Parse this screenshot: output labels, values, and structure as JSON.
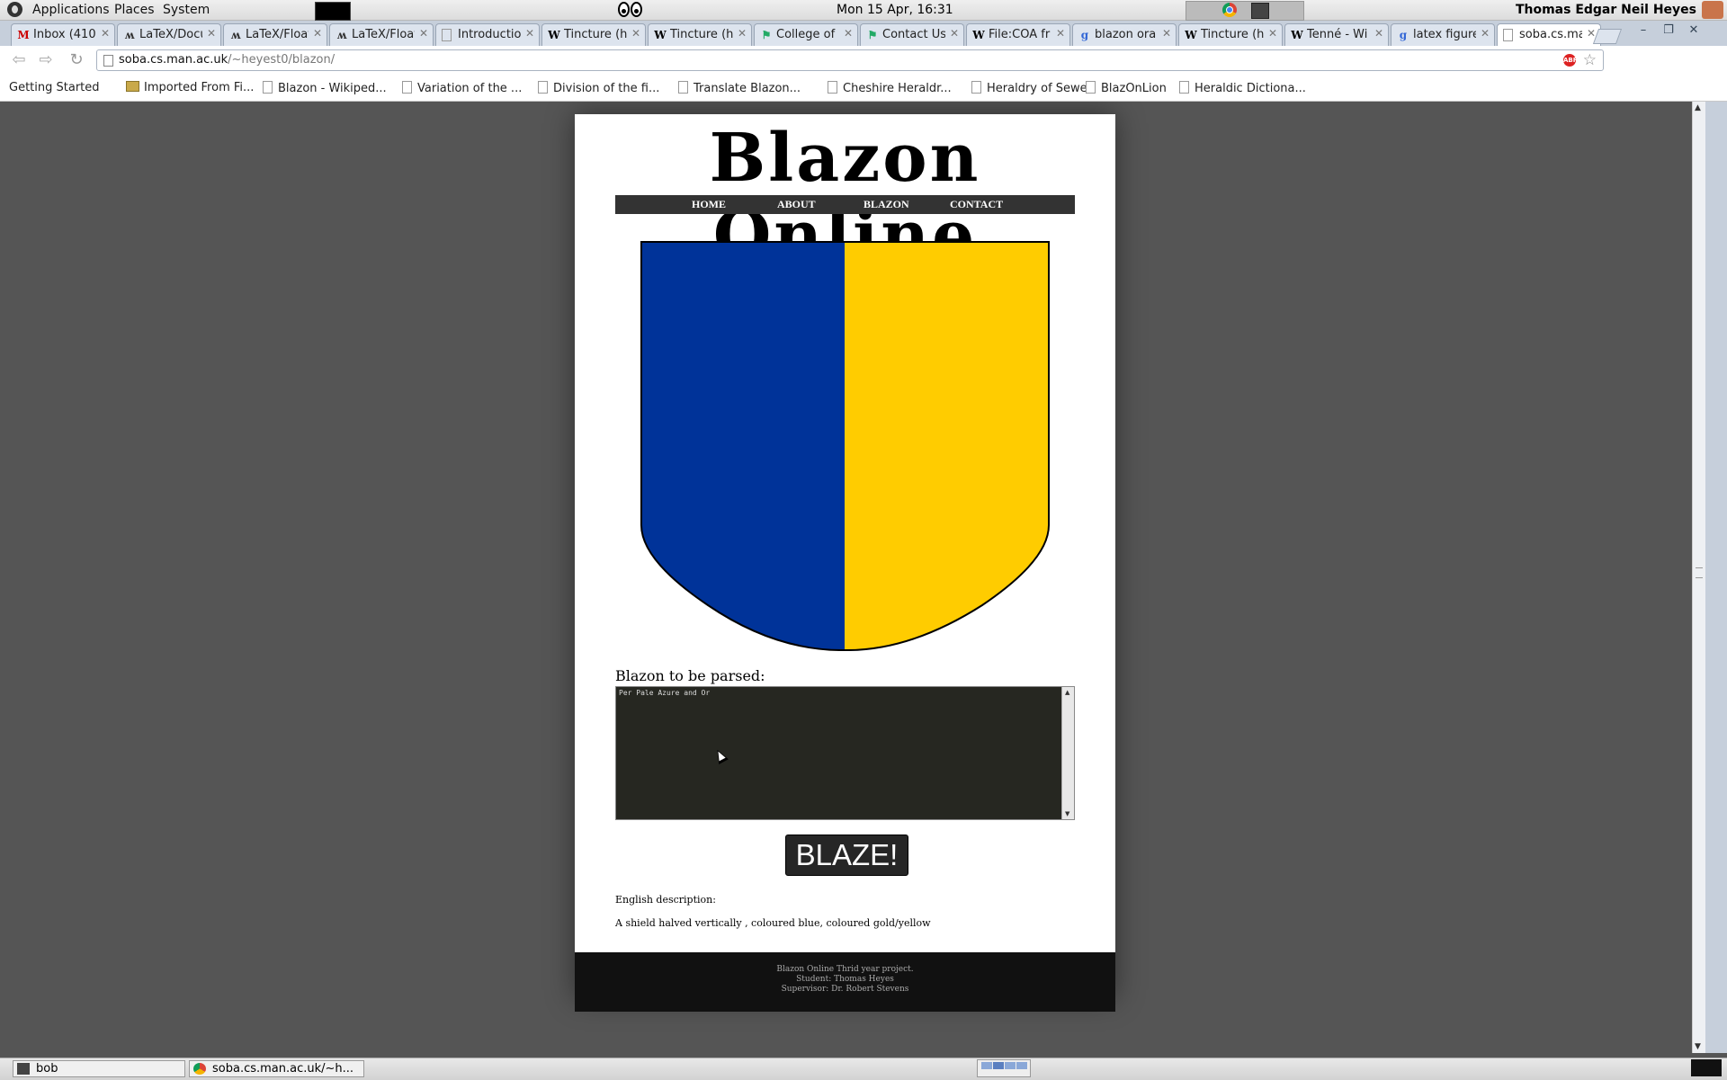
{
  "panel": {
    "menus": [
      "Applications",
      "Places",
      "System"
    ],
    "clock": "Mon 15 Apr, 16:31",
    "user": "Thomas Edgar Neil Heyes"
  },
  "tabs": [
    {
      "favicon": "gmail-icon",
      "label": "Inbox (410",
      "active": false
    },
    {
      "favicon": "wikibooks-icon",
      "label": "LaTeX/Docu",
      "active": false
    },
    {
      "favicon": "wikibooks-icon",
      "label": "LaTeX/Float",
      "active": false
    },
    {
      "favicon": "wikibooks-icon",
      "label": "LaTeX/Float",
      "active": false
    },
    {
      "favicon": "page-icon",
      "label": "Introductio",
      "active": false
    },
    {
      "favicon": "wikipedia-icon",
      "label": "Tincture (h",
      "active": false
    },
    {
      "favicon": "wikipedia-icon",
      "label": "Tincture (h",
      "active": false
    },
    {
      "favicon": "arms-icon",
      "label": "College of",
      "active": false
    },
    {
      "favicon": "arms-icon",
      "label": "Contact Us",
      "active": false
    },
    {
      "favicon": "wikipedia-icon",
      "label": "File:COA fr",
      "active": false
    },
    {
      "favicon": "google-icon",
      "label": "blazon ora",
      "active": false
    },
    {
      "favicon": "wikipedia-icon",
      "label": "Tincture (h",
      "active": false
    },
    {
      "favicon": "wikipedia-icon",
      "label": "Tenné - Wi",
      "active": false
    },
    {
      "favicon": "google-icon",
      "label": "latex figure",
      "active": false
    },
    {
      "favicon": "page-icon",
      "label": "soba.cs.ma",
      "active": true
    }
  ],
  "address": {
    "host": "soba.cs.man.ac.uk",
    "path": "/~heyest0/blazon/"
  },
  "bookmarks": [
    {
      "label": "Getting Started",
      "icon": "none"
    },
    {
      "label": "Imported From Fi...",
      "icon": "folder-icon"
    },
    {
      "label": "Blazon - Wikiped...",
      "icon": "page-icon"
    },
    {
      "label": "Variation of the ...",
      "icon": "page-icon"
    },
    {
      "label": "Division of the fi...",
      "icon": "page-icon"
    },
    {
      "label": "Translate Blazon...",
      "icon": "page-icon"
    },
    {
      "label": "Cheshire Heraldr...",
      "icon": "page-icon"
    },
    {
      "label": "Heraldry of Sewell",
      "icon": "page-icon"
    },
    {
      "label": "BlazOnLion",
      "icon": "page-icon"
    },
    {
      "label": "Heraldic Dictiona...",
      "icon": "page-icon"
    }
  ],
  "site": {
    "title": "Blazon Online",
    "nav": [
      "HOME",
      "ABOUT",
      "BLAZON",
      "CONTACT"
    ],
    "shield": {
      "dexter_color": "#003399",
      "sinister_color": "#FFCC00",
      "outline_color": "#000000"
    },
    "parse_label": "Blazon to be parsed:",
    "blazon_value": "Per Pale Azure and Or",
    "blaze_button": "BLAZE!",
    "english_label": "English description:",
    "english_text": "A shield halved vertically , coloured blue, coloured gold/yellow",
    "footer": [
      "Blazon Online Thrid year project.",
      "Student: Thomas Heyes",
      "Supervisor: Dr. Robert Stevens"
    ]
  },
  "taskbar": {
    "tasks": [
      {
        "label": "bob",
        "icon": "terminal-icon"
      },
      {
        "label": "soba.cs.man.ac.uk/~h...",
        "icon": "chrome-icon"
      }
    ]
  },
  "colors": {
    "panel_bg": "#e4e4e4",
    "page_bg": "#555555",
    "nav_bg": "#333333",
    "textarea_bg": "#262721",
    "footer_bg": "#111111"
  }
}
